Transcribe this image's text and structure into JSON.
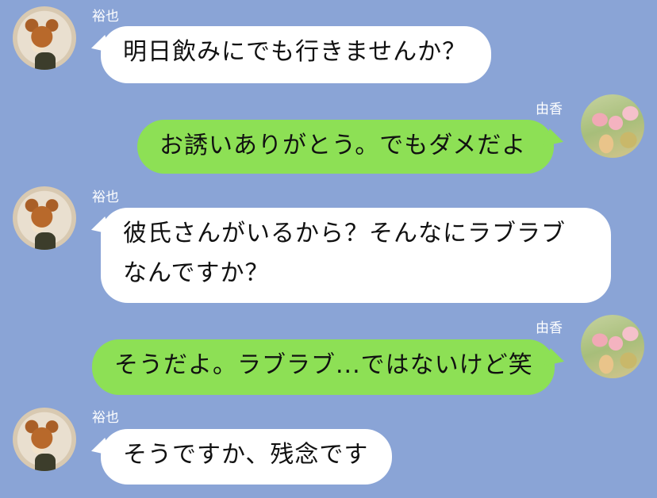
{
  "messages": [
    {
      "sender": "裕也",
      "side": "in",
      "lines": [
        "明日飲みにでも行きませんか？"
      ]
    },
    {
      "sender": "由香",
      "side": "out",
      "lines": [
        "お誘いありがとう。でもダメだよ"
      ]
    },
    {
      "sender": "裕也",
      "side": "in",
      "lines": [
        "彼氏さんがいるから？そんなにラブラブ",
        "なんですか？"
      ]
    },
    {
      "sender": "由香",
      "side": "out",
      "lines": [
        "そうだよ。ラブラブ...ではないけど笑"
      ]
    },
    {
      "sender": "裕也",
      "side": "in",
      "lines": [
        "そうですか、残念です"
      ]
    }
  ],
  "colors": {
    "background": "#8aa4d6",
    "incoming_bubble": "#ffffff",
    "outgoing_bubble": "#8de055"
  },
  "icons": {
    "yuya_avatar": "shiba-dog-avatar",
    "yuka_avatar": "tulip-flower-avatar"
  }
}
